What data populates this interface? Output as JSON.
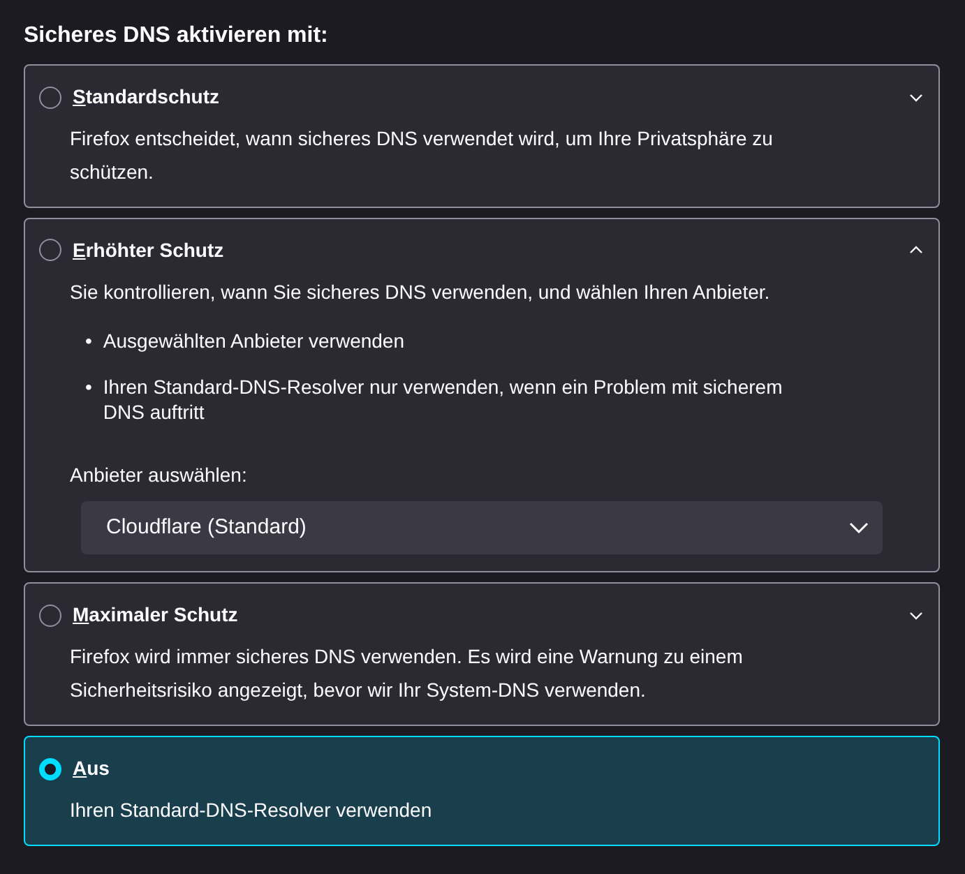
{
  "heading": "Sicheres DNS aktivieren mit:",
  "options": [
    {
      "title": "Standardschutz",
      "selected": false,
      "expanded": false,
      "description": "Firefox entscheidet, wann sicheres DNS verwendet wird, um Ihre Privatsphäre zu schützen."
    },
    {
      "title": "Erhöhter Schutz",
      "selected": false,
      "expanded": true,
      "description": "Sie kontrollieren, wann Sie sicheres DNS verwenden, und wählen Ihren Anbieter.",
      "bullets": [
        {
          "marker": "•",
          "text": "Ausgewählten Anbieter verwenden"
        },
        {
          "marker": "•",
          "text": "Ihren Standard-DNS-Resolver nur verwenden, wenn ein Problem mit sicherem DNS auftritt"
        }
      ],
      "provider_label": "Anbieter auswählen:",
      "provider_value": "Cloudflare (Standard)"
    },
    {
      "title": "Maximaler Schutz",
      "selected": false,
      "expanded": false,
      "description": "Firefox wird immer sicheres DNS verwenden. Es wird eine Warnung zu einem Sicherheitsrisiko angezeigt, bevor wir Ihr System-DNS verwenden."
    },
    {
      "title": "Aus",
      "selected": true,
      "description": "Ihren Standard-DNS-Resolver verwenden"
    }
  ]
}
